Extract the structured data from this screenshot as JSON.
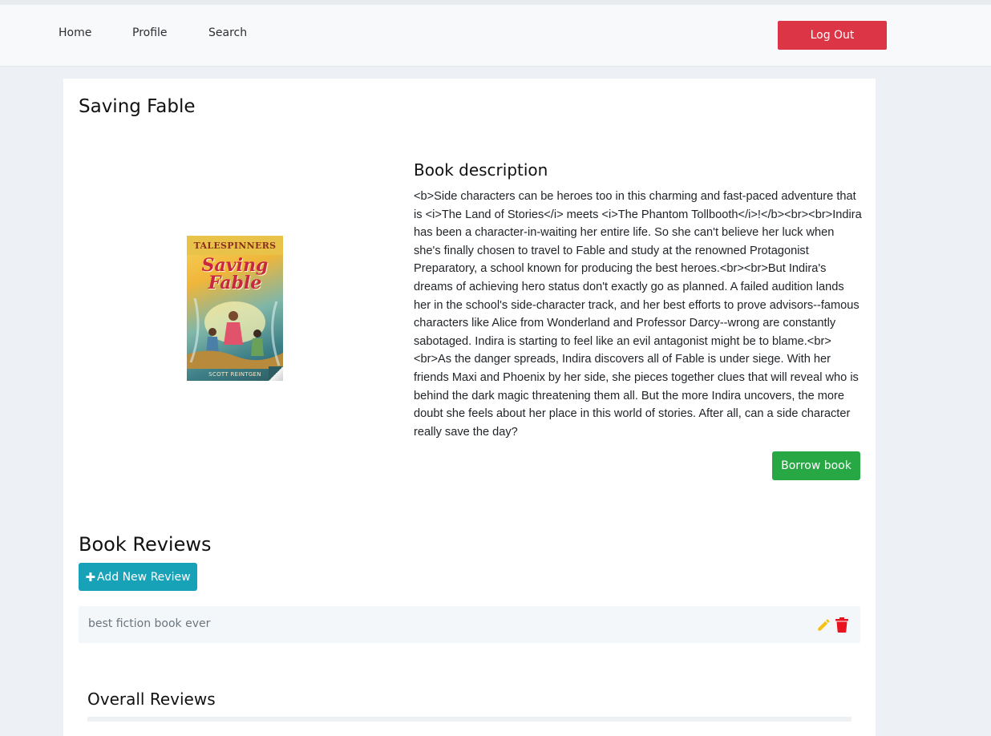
{
  "nav": {
    "links": [
      "Home",
      "Profile",
      "Search"
    ],
    "logout_label": "Log Out"
  },
  "book": {
    "title": "Saving Fable",
    "cover": {
      "series": "TALESPINNERS",
      "name": "Saving Fable",
      "author": "SCOTT REINTGEN"
    },
    "description_heading": "Book description",
    "description": "<b>Side characters can be heroes too in this charming and fast-paced adventure that is <i>The Land of Stories</i> meets <i>The Phantom Tollbooth</i>!</b><br><br>Indira has been a character-in-waiting her entire life. So she can't believe her luck when she's finally chosen to travel to Fable and study at the renowned Protagonist Preparatory, a school known for producing the best heroes.<br><br>But Indira's dreams of achieving hero status don't exactly go as planned. A failed audition lands her in the school's side-character track, and her best efforts to prove advisors--famous characters like Alice from Wonderland and Professor Darcy--wrong are constantly sabotaged. Indira is starting to feel like an evil antagonist might be to blame.<br><br>As the danger spreads, Indira discovers all of Fable is under siege. With her friends Maxi and Phoenix by her side, she pieces together clues that will reveal who is behind the dark magic threatening them all. But the more Indira uncovers, the more doubt she feels about her place in this world of stories. After all, can a side character really save the day?",
    "borrow_label": "Borrow book"
  },
  "reviews": {
    "heading": "Book Reviews",
    "add_label": "Add New Review",
    "add_icon": "plus-icon",
    "items": [
      {
        "text": "best fiction book ever",
        "edit_icon": "pencil-icon",
        "delete_icon": "trash-icon"
      }
    ],
    "overall_heading": "Overall Reviews"
  },
  "colors": {
    "danger": "#dc3545",
    "success": "#28a745",
    "info": "#17a2b8",
    "edit_icon": "#f5c211",
    "delete_icon": "#e8141f"
  }
}
